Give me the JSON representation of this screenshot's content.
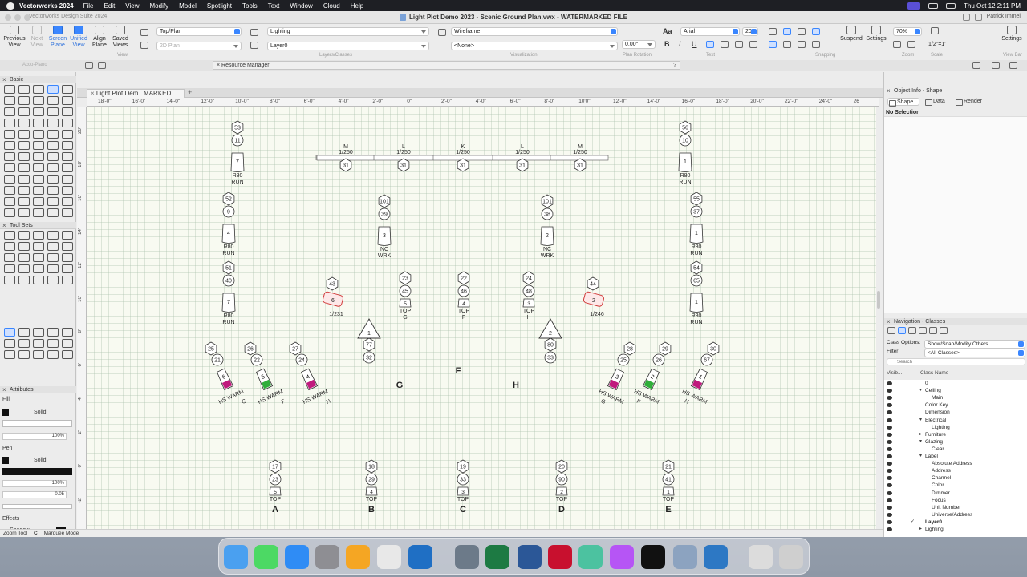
{
  "menubar": {
    "app": "Vectorworks 2024",
    "items": [
      "File",
      "Edit",
      "View",
      "Modify",
      "Model",
      "Spotlight",
      "Tools",
      "Text",
      "Window",
      "Cloud",
      "Help"
    ],
    "clock": "Thu Oct 12  2:11 PM"
  },
  "window": {
    "app_label": "Vectorworks Design Suite 2024",
    "title": "Light Plot Demo 2023 - Scenic Ground Plan.vwx - WATERMARKED FILE",
    "user": "Patrick Immel"
  },
  "toolbar": {
    "buttons": [
      {
        "label1": "Previous",
        "label2": "View"
      },
      {
        "label1": "Next",
        "label2": "View"
      },
      {
        "label1": "Screen",
        "label2": "Plane"
      },
      {
        "label1": "Unified",
        "label2": "View"
      },
      {
        "label1": "Align",
        "label2": "Plane"
      },
      {
        "label1": "Saved",
        "label2": "Views"
      }
    ],
    "view_group": "View",
    "view_value": "Top/Plan",
    "plane_value": "2D Plan",
    "class_value": "Lighting",
    "layer_value": "Layer0",
    "layers_group": "Layers/Classes",
    "render_value": "Wireframe",
    "light_value": "<None>",
    "visualization_group": "Visualization",
    "rotation_value": "0.00°",
    "rotation_group": "Plan Rotation",
    "font_value": "Arial",
    "font_size": "20",
    "text_group": "Text",
    "snapping_group": "Snapping",
    "suspend": "Suspend",
    "settings": "Settings",
    "zoom_value": "70%",
    "zoom_group": "Zoom",
    "scale_value": "1/2\"=1'",
    "scale_group": "Scale",
    "settings_right": "Settings",
    "viewbar_group": "View Bar"
  },
  "subbar": {
    "resource_manager": "Resource Manager",
    "help": "?",
    "left_tab": "Acco-Plano"
  },
  "left_palettes": {
    "basic": "Basic",
    "tool_sets": "Tool Sets",
    "attributes": "Attributes",
    "fill": "Fill",
    "fill_style": "Solid",
    "fill_opacity": "100%",
    "pen": "Pen",
    "pen_style": "Solid",
    "pen_opacity": "100%",
    "line_weight": "0.05",
    "effects": "Effects",
    "shadow": "Shadow"
  },
  "doc_tab": "Light Plot Dem...MARKED FILE",
  "ruler_labels": [
    "18'-0\"",
    "16'-0\"",
    "14'-0\"",
    "12'-0\"",
    "10'-0\"",
    "8'-0\"",
    "6'-0\"",
    "4'-0\"",
    "2'-0\"",
    "0\"",
    "2'-0\"",
    "4'-0\"",
    "6'-0\"",
    "8'-0\"",
    "10'0\"",
    "12'-0\"",
    "14'-0\"",
    "16'-0\"",
    "18'-0\"",
    "20'-0\"",
    "22'-0\"",
    "24'-0\"",
    "26"
  ],
  "plot": {
    "fixtures": [
      {
        "tags": [
          "53",
          "11",
          "7"
        ],
        "labels": [
          "R80",
          "RUN"
        ]
      },
      {
        "tags": [
          "52",
          "9",
          "4"
        ],
        "labels": [
          "R80",
          "RUN"
        ]
      },
      {
        "tags": [
          "51",
          "40",
          "7"
        ],
        "labels": [
          "R80",
          "RUN"
        ]
      },
      {
        "tags": [
          "56",
          "10",
          "1"
        ],
        "labels": [
          "R80",
          "RUN"
        ]
      },
      {
        "tags": [
          "55",
          "37",
          "1"
        ],
        "labels": [
          "R80",
          "RUN"
        ]
      },
      {
        "tags": [
          "54",
          "65",
          "1"
        ],
        "labels": [
          "R80",
          "RUN"
        ]
      },
      {
        "tags": [
          "101",
          "39",
          "3"
        ],
        "labels": [
          "NC",
          "WRK"
        ]
      },
      {
        "tags": [
          "101",
          "38",
          "2"
        ],
        "labels": [
          "NC",
          "WRK"
        ]
      },
      {
        "tags": [
          "23",
          "45",
          "5"
        ],
        "labels": [
          "TOP",
          "G"
        ]
      },
      {
        "tags": [
          "22",
          "46",
          "4"
        ],
        "labels": [
          "TOP",
          "F"
        ]
      },
      {
        "tags": [
          "24",
          "48",
          "3"
        ],
        "labels": [
          "TOP",
          "H"
        ]
      },
      {
        "tags": [
          "17",
          "23",
          "5"
        ],
        "labels": [
          "TOP",
          "A"
        ]
      },
      {
        "tags": [
          "18",
          "29",
          "4"
        ],
        "labels": [
          "TOP",
          "B"
        ]
      },
      {
        "tags": [
          "19",
          "33",
          "3"
        ],
        "labels": [
          "TOP",
          "C"
        ]
      },
      {
        "tags": [
          "20",
          "90",
          "2"
        ],
        "labels": [
          "TOP",
          "D"
        ]
      },
      {
        "tags": [
          "21",
          "41",
          "1"
        ],
        "labels": [
          "TOP",
          "E"
        ]
      },
      {
        "tags": [
          "25",
          "21",
          "6"
        ],
        "labels": [
          "HS WARM",
          "G"
        ]
      },
      {
        "tags": [
          "26",
          "22",
          "5"
        ],
        "labels": [
          "HS WARM",
          "F"
        ]
      },
      {
        "tags": [
          "27",
          "24",
          "4"
        ],
        "labels": [
          "HS WARM",
          "H"
        ]
      },
      {
        "tags": [
          "28",
          "25",
          "3"
        ],
        "labels": [
          "HS WARM",
          "G"
        ]
      },
      {
        "tags": [
          "29",
          "26",
          "2"
        ],
        "labels": [
          "HS WARM",
          "F"
        ]
      },
      {
        "tags": [
          "30",
          "67",
          "1"
        ],
        "labels": [
          "HS WARM",
          "H"
        ]
      }
    ],
    "pipe_units": [
      {
        "letter": "M",
        "gobo": "1/250",
        "ch": "31"
      },
      {
        "letter": "L",
        "gobo": "1/250",
        "ch": "31"
      },
      {
        "letter": "K",
        "gobo": "1/250",
        "ch": "31"
      },
      {
        "letter": "L",
        "gobo": "1/250",
        "ch": "31"
      },
      {
        "letter": "M",
        "gobo": "1/250",
        "ch": "31"
      }
    ],
    "movers": [
      {
        "tag": "43",
        "unit": "6",
        "addr": "1/231"
      },
      {
        "tag": "44",
        "unit": "2",
        "addr": "1/246"
      }
    ],
    "triangles": [
      {
        "unit": "1",
        "tags": [
          "77",
          "32"
        ]
      },
      {
        "unit": "2",
        "tags": [
          "80",
          "33"
        ]
      }
    ],
    "area_letters": [
      "F",
      "G",
      "H"
    ]
  },
  "object_info": {
    "title": "Object Info - Shape",
    "tabs": [
      "Shape",
      "Data",
      "Render"
    ],
    "selection": "No Selection"
  },
  "navigation": {
    "title": "Navigation - Classes",
    "class_options_label": "Class Options:",
    "class_options_value": "Show/Snap/Modify Others",
    "filter_label": "Filter:",
    "filter_value": "<All Classes>",
    "search_placeholder": "Search",
    "col_visib": "Visib...",
    "col_class": "Class Name",
    "classes": [
      {
        "name": "0",
        "level": 0,
        "arrow": ""
      },
      {
        "name": "Ceiling",
        "level": 0,
        "arrow": "▾"
      },
      {
        "name": "Main",
        "level": 1,
        "arrow": ""
      },
      {
        "name": "Color Key",
        "level": 0,
        "arrow": ""
      },
      {
        "name": "Dimension",
        "level": 0,
        "arrow": ""
      },
      {
        "name": "Electrical",
        "level": 0,
        "arrow": "▾"
      },
      {
        "name": "Lighting",
        "level": 1,
        "arrow": ""
      },
      {
        "name": "Furniture",
        "level": 0,
        "arrow": "▸"
      },
      {
        "name": "Glazing",
        "level": 0,
        "arrow": "▾"
      },
      {
        "name": "Clear",
        "level": 1,
        "arrow": ""
      },
      {
        "name": "Label",
        "level": 0,
        "arrow": "▾"
      },
      {
        "name": "Absolute Address",
        "level": 1,
        "arrow": ""
      },
      {
        "name": "Address",
        "level": 1,
        "arrow": ""
      },
      {
        "name": "Channel",
        "level": 1,
        "arrow": ""
      },
      {
        "name": "Color",
        "level": 1,
        "arrow": ""
      },
      {
        "name": "Dimmer",
        "level": 1,
        "arrow": ""
      },
      {
        "name": "Focus",
        "level": 1,
        "arrow": ""
      },
      {
        "name": "Unit Number",
        "level": 1,
        "arrow": ""
      },
      {
        "name": "Universe/Address",
        "level": 1,
        "arrow": ""
      },
      {
        "name": "Layer0",
        "level": 0,
        "arrow": "",
        "bold": true,
        "check": true
      },
      {
        "name": "Lighting",
        "level": 0,
        "arrow": "▸"
      }
    ]
  },
  "status": {
    "tool": "Zoom Tool",
    "key": "C",
    "mode": "Marquee Mode"
  },
  "colors": {
    "accent": "#3a86ff",
    "canvas": "#f8faf1",
    "magenta_gel": "#c0197d",
    "green_gel": "#2fae3a",
    "mover_red": "#d13a3a"
  },
  "dock_icons": [
    "finder-icon",
    "messages-icon",
    "app-store-icon",
    "system-settings-icon",
    "launchpad-icon",
    "chrome-icon",
    "outlook-icon",
    "quicktime-icon",
    "excel-icon",
    "word-icon",
    "acrobat-icon",
    "maps-icon",
    "affinity-icon",
    "vectorworks-icon",
    "preview-icon",
    "s-app-icon",
    "downloads-icon",
    "trash-icon"
  ]
}
